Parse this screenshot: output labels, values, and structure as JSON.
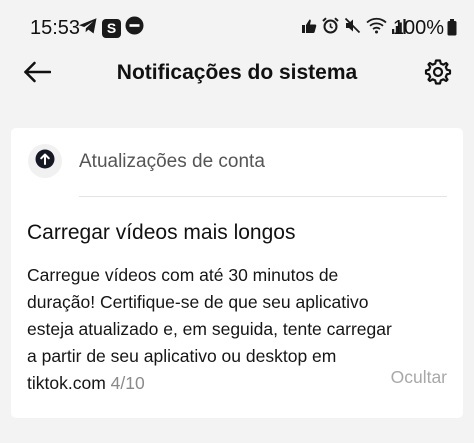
{
  "status_bar": {
    "time": "15:53",
    "s_badge": "S",
    "battery": "100%",
    "left_icons": [
      "telegram-icon",
      "s-app-icon",
      "do-not-disturb-icon"
    ],
    "right_icons": [
      "thumbs-up-icon",
      "alarm-icon",
      "mute-icon",
      "wifi-icon",
      "signal-icon",
      "battery-icon"
    ]
  },
  "header": {
    "title": "Notificações do sistema"
  },
  "card": {
    "section_title": "Atualizações de conta",
    "notification": {
      "title": "Carregar vídeos mais longos",
      "body_lines": [
        "Carregue vídeos com até 30 minutos de",
        "duração! Certifique-se de que seu aplicativo",
        "esteja atualizado e, em seguida, tente carregar",
        "a partir de seu aplicativo ou desktop em",
        "tiktok.com"
      ],
      "date": "4/10",
      "hide_label": "Ocultar"
    }
  },
  "colors": {
    "background": "#f3f3f3",
    "card": "#ffffff",
    "muted": "#8a8a8a",
    "hide": "#a8a8a8"
  }
}
